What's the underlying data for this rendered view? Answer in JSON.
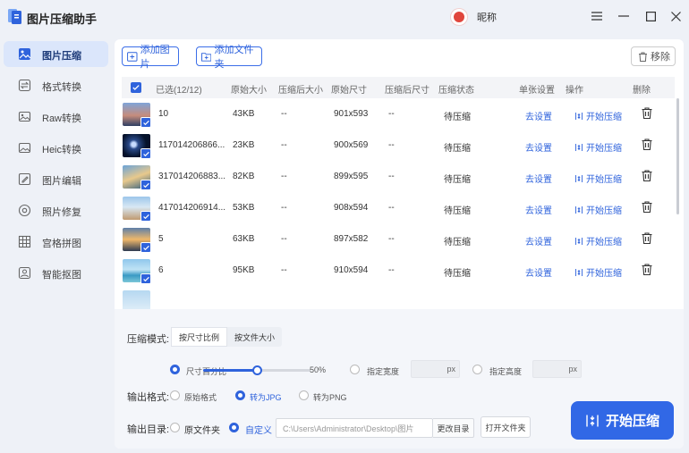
{
  "app": {
    "title": "图片压缩助手",
    "nickname": "昵称"
  },
  "colors": {
    "accent": "#2f63dc",
    "start_button": "#3168e6",
    "active_nav_bg": "#dbe6fb"
  },
  "sidebar": {
    "items": [
      {
        "label": "图片压缩",
        "icon": "image-compress-icon",
        "active": true
      },
      {
        "label": "格式转换",
        "icon": "format-convert-icon",
        "active": false
      },
      {
        "label": "Raw转换",
        "icon": "raw-convert-icon",
        "active": false
      },
      {
        "label": "Heic转换",
        "icon": "heic-convert-icon",
        "active": false
      },
      {
        "label": "图片编辑",
        "icon": "image-edit-icon",
        "active": false
      },
      {
        "label": "照片修复",
        "icon": "photo-repair-icon",
        "active": false
      },
      {
        "label": "宫格拼图",
        "icon": "grid-collage-icon",
        "active": false
      },
      {
        "label": "智能抠图",
        "icon": "smart-cutout-icon",
        "active": false
      }
    ]
  },
  "toolbar": {
    "add_image": "添加图片",
    "add_folder": "添加文件夹",
    "remove": "移除"
  },
  "table": {
    "headers": {
      "selected": "已选(12/12)",
      "orig_size": "原始大小",
      "comp_size": "压缩后大小",
      "orig_dim": "原始尺寸",
      "comp_dim": "压缩后尺寸",
      "status": "压缩状态",
      "single": "单张设置",
      "ops": "操作",
      "delete": "删除"
    },
    "rows": [
      {
        "name": "10",
        "orig_size": "43KB",
        "comp_size": "--",
        "orig_dim": "901x593",
        "comp_dim": "--",
        "status": "待压缩",
        "setting": "去设置",
        "action": "开始压缩"
      },
      {
        "name": "117014206866...",
        "orig_size": "23KB",
        "comp_size": "--",
        "orig_dim": "900x569",
        "comp_dim": "--",
        "status": "待压缩",
        "setting": "去设置",
        "action": "开始压缩"
      },
      {
        "name": "317014206883...",
        "orig_size": "82KB",
        "comp_size": "--",
        "orig_dim": "899x595",
        "comp_dim": "--",
        "status": "待压缩",
        "setting": "去设置",
        "action": "开始压缩"
      },
      {
        "name": "417014206914...",
        "orig_size": "53KB",
        "comp_size": "--",
        "orig_dim": "908x594",
        "comp_dim": "--",
        "status": "待压缩",
        "setting": "去设置",
        "action": "开始压缩"
      },
      {
        "name": "5",
        "orig_size": "63KB",
        "comp_size": "--",
        "orig_dim": "897x582",
        "comp_dim": "--",
        "status": "待压缩",
        "setting": "去设置",
        "action": "开始压缩"
      },
      {
        "name": "6",
        "orig_size": "95KB",
        "comp_size": "--",
        "orig_dim": "910x594",
        "comp_dim": "--",
        "status": "待压缩",
        "setting": "去设置",
        "action": "开始压缩"
      }
    ]
  },
  "settings": {
    "mode_label": "压缩模式:",
    "mode_options": [
      "按尺寸比例",
      "按文件大小"
    ],
    "mode_selected": 0,
    "percent_label": "尺寸百分比",
    "percent_value": "50%",
    "percent_fraction": 0.5,
    "width_label": "指定宽度",
    "height_label": "指定高度",
    "px_unit": "px",
    "format_label": "输出格式:",
    "format_options": [
      "原始格式",
      "转为JPG",
      "转为PNG"
    ],
    "format_selected": 1,
    "output_label": "输出目录:",
    "dir_options": [
      "原文件夹",
      "自定义"
    ],
    "dir_selected": 1,
    "path": "C:\\Users\\Administrator\\Desktop\\图片",
    "change_dir": "更改目录",
    "open_folder": "打开文件夹",
    "start": "开始压缩"
  }
}
